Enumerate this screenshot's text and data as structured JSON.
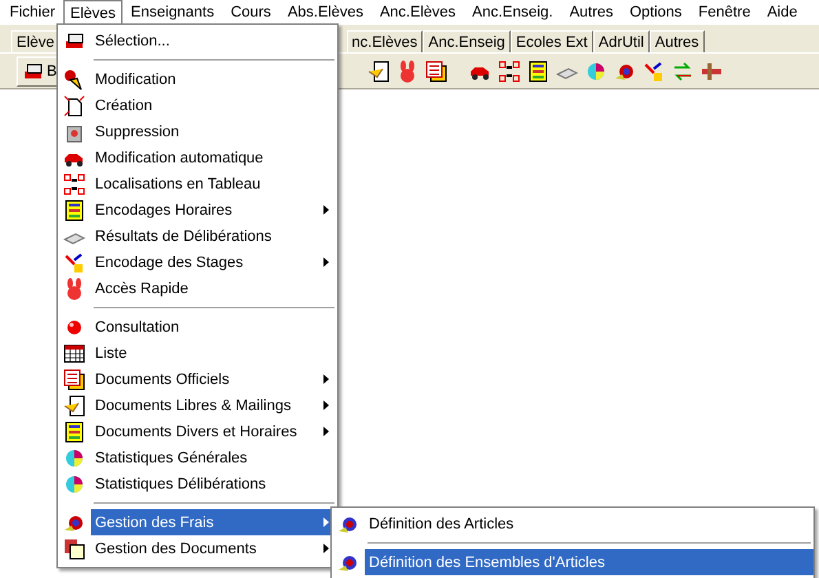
{
  "menubar": [
    {
      "label": "Fichier",
      "selected": false
    },
    {
      "label": "Elèves",
      "selected": true
    },
    {
      "label": "Enseignants",
      "selected": false
    },
    {
      "label": "Cours",
      "selected": false
    },
    {
      "label": "Abs.Elèves",
      "selected": false
    },
    {
      "label": "Anc.Elèves",
      "selected": false
    },
    {
      "label": "Anc.Enseig.",
      "selected": false
    },
    {
      "label": "Autres",
      "selected": false
    },
    {
      "label": "Options",
      "selected": false
    },
    {
      "label": "Fenêtre",
      "selected": false
    },
    {
      "label": "Aide",
      "selected": false
    }
  ],
  "tabs_left": [
    {
      "label": "Elève"
    }
  ],
  "tabs_right": [
    {
      "label": "nc.Elèves"
    },
    {
      "label": "Anc.Enseig"
    },
    {
      "label": "Ecoles Ext"
    },
    {
      "label": "AdrUtil"
    },
    {
      "label": "Autres"
    }
  ],
  "toolbar_button": {
    "label": "B"
  },
  "menu": [
    {
      "kind": "item",
      "label": "Sélection...",
      "has_submenu": false,
      "selected": false
    },
    {
      "kind": "separator"
    },
    {
      "kind": "item",
      "label": "Modification",
      "has_submenu": false,
      "selected": false
    },
    {
      "kind": "item",
      "label": "Création",
      "has_submenu": false,
      "selected": false
    },
    {
      "kind": "item",
      "label": "Suppression",
      "has_submenu": false,
      "selected": false
    },
    {
      "kind": "item",
      "label": "Modification automatique",
      "has_submenu": false,
      "selected": false
    },
    {
      "kind": "item",
      "label": "Localisations en Tableau",
      "has_submenu": false,
      "selected": false
    },
    {
      "kind": "item",
      "label": "Encodages Horaires",
      "has_submenu": true,
      "selected": false
    },
    {
      "kind": "item",
      "label": "Résultats de Délibérations",
      "has_submenu": false,
      "selected": false
    },
    {
      "kind": "item",
      "label": "Encodage des Stages",
      "has_submenu": true,
      "selected": false
    },
    {
      "kind": "item",
      "label": "Accès Rapide",
      "has_submenu": false,
      "selected": false
    },
    {
      "kind": "separator"
    },
    {
      "kind": "item",
      "label": "Consultation",
      "has_submenu": false,
      "selected": false
    },
    {
      "kind": "item",
      "label": "Liste",
      "has_submenu": false,
      "selected": false
    },
    {
      "kind": "item",
      "label": "Documents Officiels",
      "has_submenu": true,
      "selected": false
    },
    {
      "kind": "item",
      "label": "Documents Libres  & Mailings",
      "has_submenu": true,
      "selected": false
    },
    {
      "kind": "item",
      "label": "Documents Divers et Horaires",
      "has_submenu": true,
      "selected": false
    },
    {
      "kind": "item",
      "label": "Statistiques Générales",
      "has_submenu": false,
      "selected": false
    },
    {
      "kind": "item",
      "label": "Statistiques Délibérations",
      "has_submenu": false,
      "selected": false
    },
    {
      "kind": "separator"
    },
    {
      "kind": "item",
      "label": "Gestion des Frais",
      "has_submenu": true,
      "selected": true
    },
    {
      "kind": "item",
      "label": "Gestion des Documents",
      "has_submenu": true,
      "selected": false
    }
  ],
  "submenu": [
    {
      "kind": "item",
      "label": "Définition des Articles",
      "selected": false
    },
    {
      "kind": "separator"
    },
    {
      "kind": "item",
      "label": "Définition des Ensembles d'Articles",
      "selected": true
    }
  ]
}
